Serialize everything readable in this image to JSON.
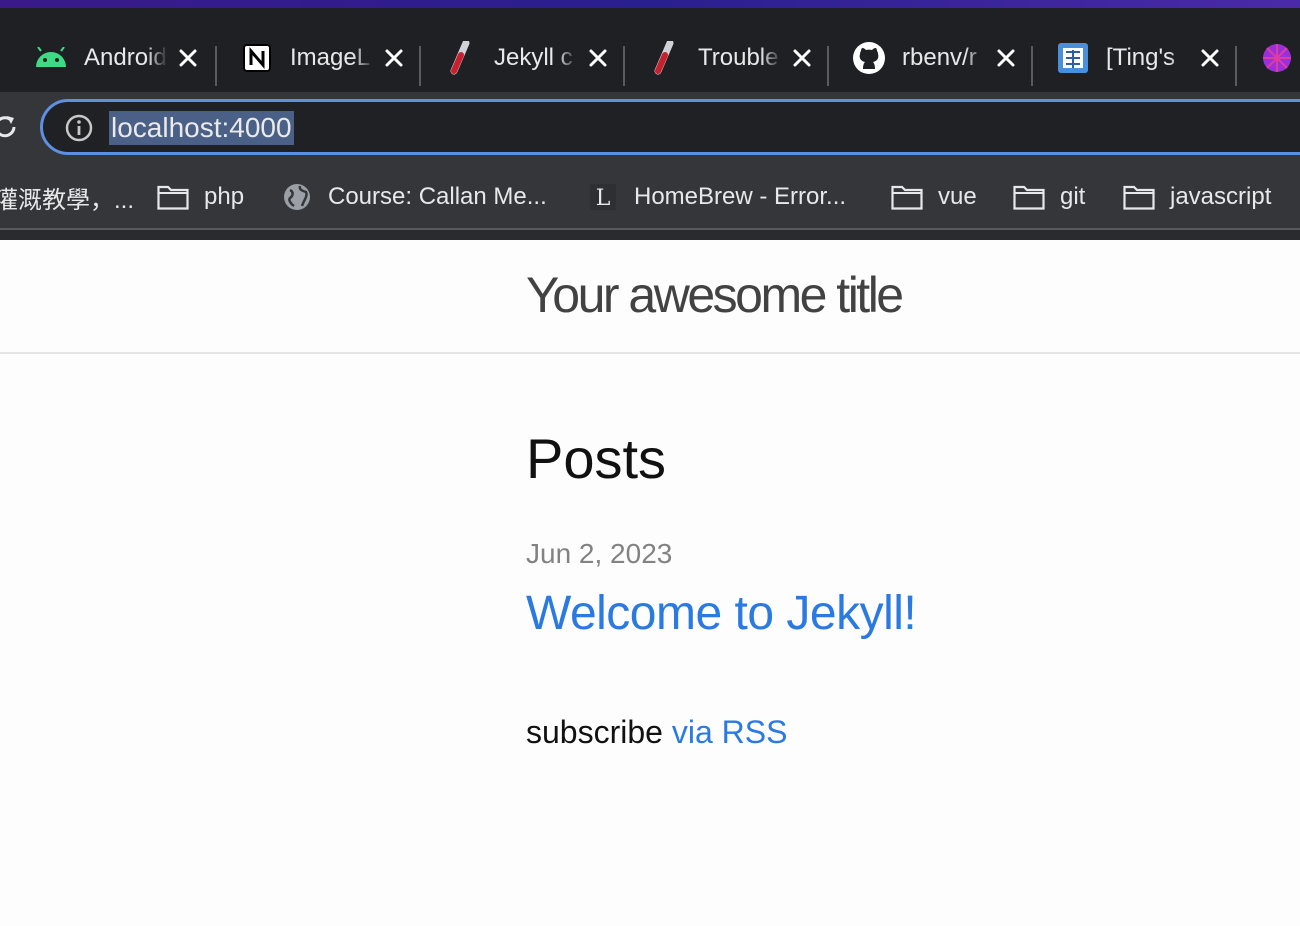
{
  "browser": {
    "tabs": [
      {
        "title": "Android",
        "icon": "android-icon"
      },
      {
        "title": "ImageL",
        "icon": "notion-icon"
      },
      {
        "title": "Jekyll c",
        "icon": "test-tube-icon"
      },
      {
        "title": "Trouble",
        "icon": "test-tube-icon"
      },
      {
        "title": "rbenv/r",
        "icon": "github-icon"
      },
      {
        "title": "[Ting's",
        "icon": "site-favicon-icon"
      }
    ],
    "url": "localhost:4000",
    "bookmarks": [
      {
        "label": "灌溉教學，...",
        "icon": "none"
      },
      {
        "label": "php",
        "icon": "folder-icon"
      },
      {
        "label": "Course: Callan Me...",
        "icon": "globe-icon"
      },
      {
        "label": "HomeBrew - Error...",
        "icon": "l-favicon-icon"
      },
      {
        "label": "vue",
        "icon": "folder-icon"
      },
      {
        "label": "git",
        "icon": "folder-icon"
      },
      {
        "label": "javascript",
        "icon": "folder-icon"
      }
    ]
  },
  "site": {
    "title": "Your awesome title",
    "posts_heading": "Posts",
    "posts": [
      {
        "date": "Jun 2, 2023",
        "title": "Welcome to Jekyll!"
      }
    ],
    "subscribe_text": "subscribe",
    "rss_link": "via RSS"
  },
  "colors": {
    "accent_link": "#2a7ae2",
    "tab_bar": "#1f2024",
    "toolbar": "#35363a",
    "omnibox_focus": "#5f8fe0"
  }
}
